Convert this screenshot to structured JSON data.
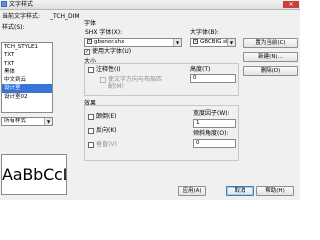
{
  "window": {
    "title": "文字样式",
    "close_glyph": "✕"
  },
  "current_style": {
    "label": "当前文字样式:",
    "value": "_TCH_DIM"
  },
  "styles": {
    "label": "样式(S):",
    "items": [
      "TCH_STYLE1",
      "TXT",
      "TXT",
      "黑体",
      "中文到云",
      "设计室",
      "设计室02"
    ],
    "selected_index": 5
  },
  "filter": {
    "value": "所有样式"
  },
  "preview": {
    "text": "AaBbCcD"
  },
  "font": {
    "group_label": "字体",
    "shx_label": "SHX 字体(X):",
    "shx_value": "gbenor.shx",
    "big_font_label": "大字体(B):",
    "big_font_value": "GBCBIG.shx",
    "use_big_font_label": "使用大字体(U)",
    "use_big_font_checked": true
  },
  "size": {
    "group_label": "大小",
    "annotative_label": "注释性(I)",
    "annotative_checked": false,
    "match_orientation_label": "使文字方向与布局匹配(M)",
    "height_label": "高度(T)",
    "height_value": "0"
  },
  "effects": {
    "group_label": "效果",
    "upside_down_label": "颠倒(E)",
    "upside_down_checked": false,
    "backwards_label": "反向(K)",
    "backwards_checked": false,
    "vertical_label": "垂直(V)",
    "vertical_checked": false,
    "width_factor_label": "宽度因子(W):",
    "width_factor_value": "1",
    "oblique_angle_label": "倾斜角度(O):",
    "oblique_angle_value": "0"
  },
  "buttons": {
    "set_current": "置为当前(C)",
    "new": "新建(N)...",
    "delete": "删除(D)",
    "apply": "应用(A)",
    "cancel": "取消",
    "help": "帮助(H)"
  }
}
